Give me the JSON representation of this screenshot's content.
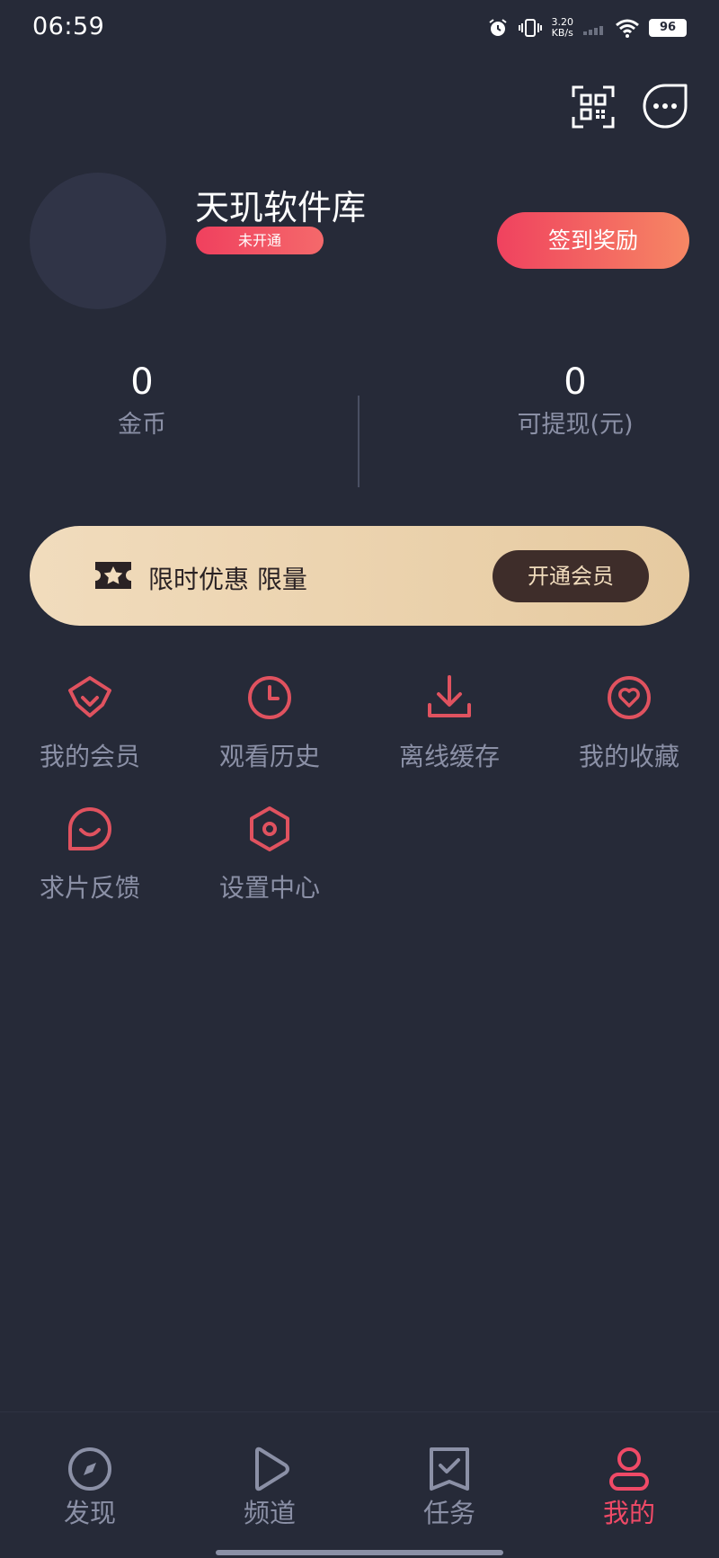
{
  "status_bar": {
    "time": "06:59",
    "net_speed_value": "3.20",
    "net_speed_unit": "KB/s",
    "battery": "96"
  },
  "profile": {
    "username": "天玑软件库",
    "vip_status": "未开通",
    "checkin_label": "签到奖励"
  },
  "stats": {
    "coins_value": "0",
    "coins_label": "金币",
    "cash_value": "0",
    "cash_label": "可提现(元)"
  },
  "promo": {
    "text": "限时优惠 限量",
    "button_label": "开通会员"
  },
  "menu": {
    "items": [
      {
        "label": "我的会员",
        "icon": "diamond-icon"
      },
      {
        "label": "观看历史",
        "icon": "clock-icon"
      },
      {
        "label": "离线缓存",
        "icon": "download-icon"
      },
      {
        "label": "我的收藏",
        "icon": "heart-icon"
      },
      {
        "label": "求片反馈",
        "icon": "feedback-icon"
      },
      {
        "label": "设置中心",
        "icon": "settings-icon"
      }
    ]
  },
  "bottom_nav": {
    "items": [
      {
        "label": "发现",
        "icon": "compass-icon"
      },
      {
        "label": "频道",
        "icon": "play-icon"
      },
      {
        "label": "任务",
        "icon": "task-icon"
      },
      {
        "label": "我的",
        "icon": "user-icon",
        "active": true
      }
    ]
  },
  "colors": {
    "background": "#262a38",
    "accent": "#f04a67",
    "icon_red": "#e0525f",
    "muted_text": "#8b90a6",
    "promo_gold": "#f1dcbd"
  }
}
